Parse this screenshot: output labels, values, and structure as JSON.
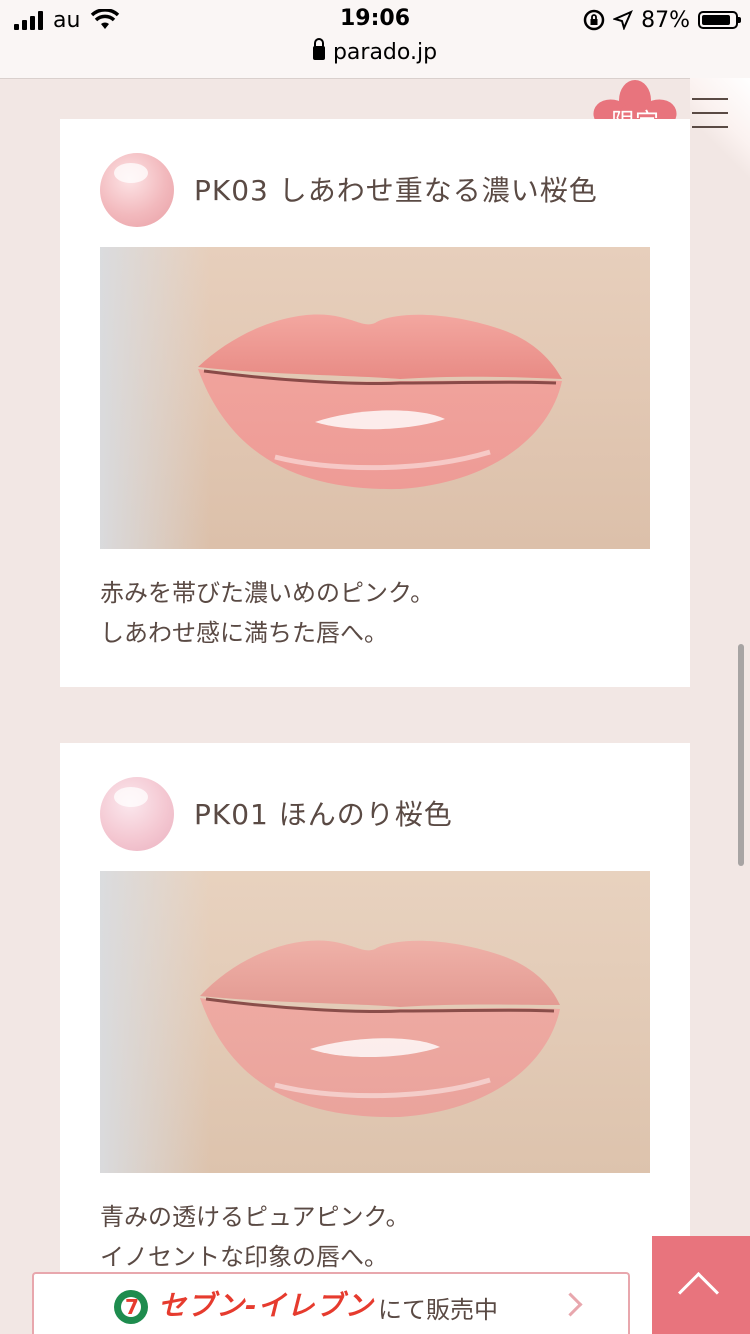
{
  "status_bar": {
    "carrier": "au",
    "time": "19:06",
    "battery": "87%",
    "url": "parado.jp"
  },
  "header": {
    "badge": "限定"
  },
  "products": [
    {
      "name": "PK03 しあわせ重なる濃い桜色",
      "swatch_color": "#f2b9bd",
      "desc_line1": "赤みを帯びた濃いめのピンク。",
      "desc_line2": "しあわせ感に満ちた唇へ。"
    },
    {
      "name": "PK01 ほんのり桜色",
      "swatch_color": "#f4c8d2",
      "desc_line1": "青みの透けるピュアピンク。",
      "desc_line2": "イノセントな印象の唇へ。"
    }
  ],
  "banner": {
    "brand": "セブン-イレブン",
    "sold_text": "にて販売中"
  },
  "colors": {
    "accent": "#e8747d",
    "background": "#f2e7e4",
    "text": "#5a4a44"
  }
}
